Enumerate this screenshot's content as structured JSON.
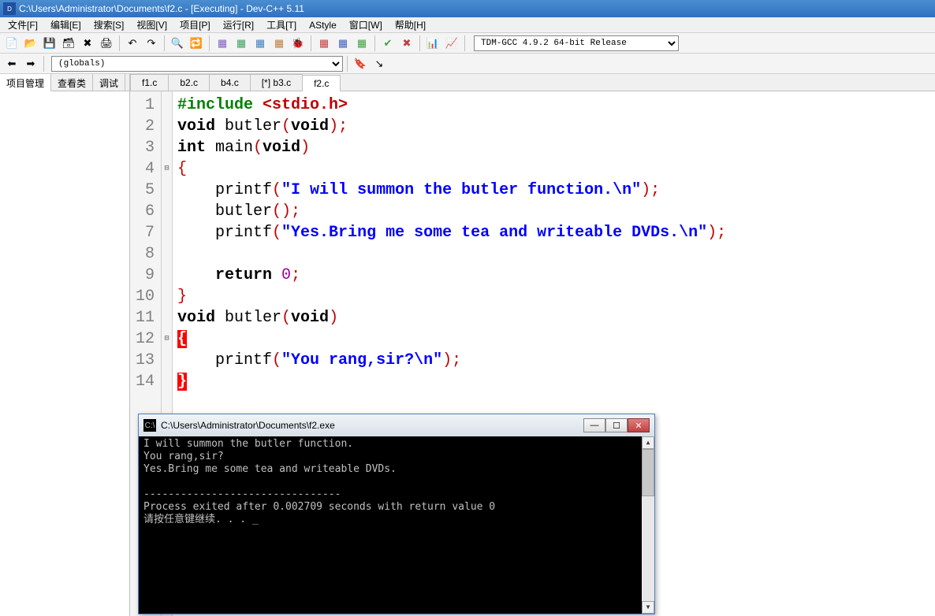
{
  "window": {
    "title": "C:\\Users\\Administrator\\Documents\\f2.c - [Executing] - Dev-C++ 5.11"
  },
  "menu": {
    "items": [
      "文件[F]",
      "编辑[E]",
      "搜索[S]",
      "视图[V]",
      "项目[P]",
      "运行[R]",
      "工具[T]",
      "AStyle",
      "窗口[W]",
      "帮助[H]"
    ]
  },
  "toolbar": {
    "compiler": "TDM-GCC 4.9.2 64-bit Release"
  },
  "toolbar2": {
    "globals": "(globals)"
  },
  "left_tabs": {
    "items": [
      "项目管理",
      "查看类",
      "调试"
    ],
    "active": 0
  },
  "file_tabs": {
    "items": [
      "f1.c",
      "b2.c",
      "b4.c",
      "[*] b3.c",
      "f2.c"
    ],
    "active": 4
  },
  "code": {
    "lines": [
      {
        "n": "1",
        "tokens": [
          [
            "pp",
            "#include "
          ],
          [
            "inc",
            "<stdio.h>"
          ]
        ]
      },
      {
        "n": "2",
        "tokens": [
          [
            "kw",
            "void"
          ],
          [
            "fn",
            " butler"
          ],
          [
            "pun",
            "("
          ],
          [
            "kw",
            "void"
          ],
          [
            "pun",
            ");"
          ]
        ]
      },
      {
        "n": "3",
        "tokens": [
          [
            "kw",
            "int"
          ],
          [
            "fn",
            " main"
          ],
          [
            "pun",
            "("
          ],
          [
            "kw",
            "void"
          ],
          [
            "pun",
            ")"
          ]
        ]
      },
      {
        "n": "4",
        "fold": "⊟",
        "tokens": [
          [
            "pun",
            "{"
          ]
        ]
      },
      {
        "n": "5",
        "tokens": [
          [
            "fn",
            "    printf"
          ],
          [
            "pun",
            "("
          ],
          [
            "str",
            "\"I will summon the butler function.\\n\""
          ],
          [
            "pun",
            ");"
          ]
        ]
      },
      {
        "n": "6",
        "tokens": [
          [
            "fn",
            "    butler"
          ],
          [
            "pun",
            "();"
          ]
        ]
      },
      {
        "n": "7",
        "tokens": [
          [
            "fn",
            "    printf"
          ],
          [
            "pun",
            "("
          ],
          [
            "str",
            "\"Yes.Bring me some tea and writeable DVDs.\\n\""
          ],
          [
            "pun",
            ");"
          ]
        ]
      },
      {
        "n": "8",
        "tokens": [
          [
            "",
            ""
          ]
        ]
      },
      {
        "n": "9",
        "tokens": [
          [
            "",
            "    "
          ],
          [
            "kw",
            "return"
          ],
          [
            "",
            " "
          ],
          [
            "num",
            "0"
          ],
          [
            "pun",
            ";"
          ]
        ]
      },
      {
        "n": "10",
        "tokens": [
          [
            "pun",
            "}"
          ]
        ]
      },
      {
        "n": "11",
        "tokens": [
          [
            "kw",
            "void"
          ],
          [
            "fn",
            " butler"
          ],
          [
            "pun",
            "("
          ],
          [
            "kw",
            "void"
          ],
          [
            "pun",
            ")"
          ]
        ]
      },
      {
        "n": "12",
        "fold": "⊟",
        "tokens": [
          [
            "brace-hl",
            "{"
          ]
        ]
      },
      {
        "n": "13",
        "tokens": [
          [
            "fn",
            "    printf"
          ],
          [
            "pun",
            "("
          ],
          [
            "str",
            "\"You rang,sir?\\n\""
          ],
          [
            "pun",
            ");"
          ]
        ]
      },
      {
        "n": "14",
        "tokens": [
          [
            "brace-hl",
            "}"
          ]
        ],
        "current": true
      }
    ]
  },
  "console": {
    "title": "C:\\Users\\Administrator\\Documents\\f2.exe",
    "output": "I will summon the butler function.\nYou rang,sir?\nYes.Bring me some tea and writeable DVDs.\n\n--------------------------------\nProcess exited after 0.002709 seconds with return value 0\n请按任意键继续. . . _"
  },
  "icons": {
    "new": "📄",
    "open": "📂",
    "save": "💾",
    "saveall": "🗃",
    "close": "✖",
    "print": "🖨",
    "undo": "↶",
    "redo": "↷",
    "find": "🔍",
    "replace": "🔁",
    "compile": "▦",
    "run": "▦",
    "compilerun": "▦",
    "rebuild": "▦",
    "debug": "🐞",
    "check": "✔",
    "cancel": "✖",
    "chart1": "📊",
    "chart2": "📈",
    "back": "⬅",
    "fwd": "➡",
    "bookmark": "🔖",
    "goto": "↘"
  }
}
